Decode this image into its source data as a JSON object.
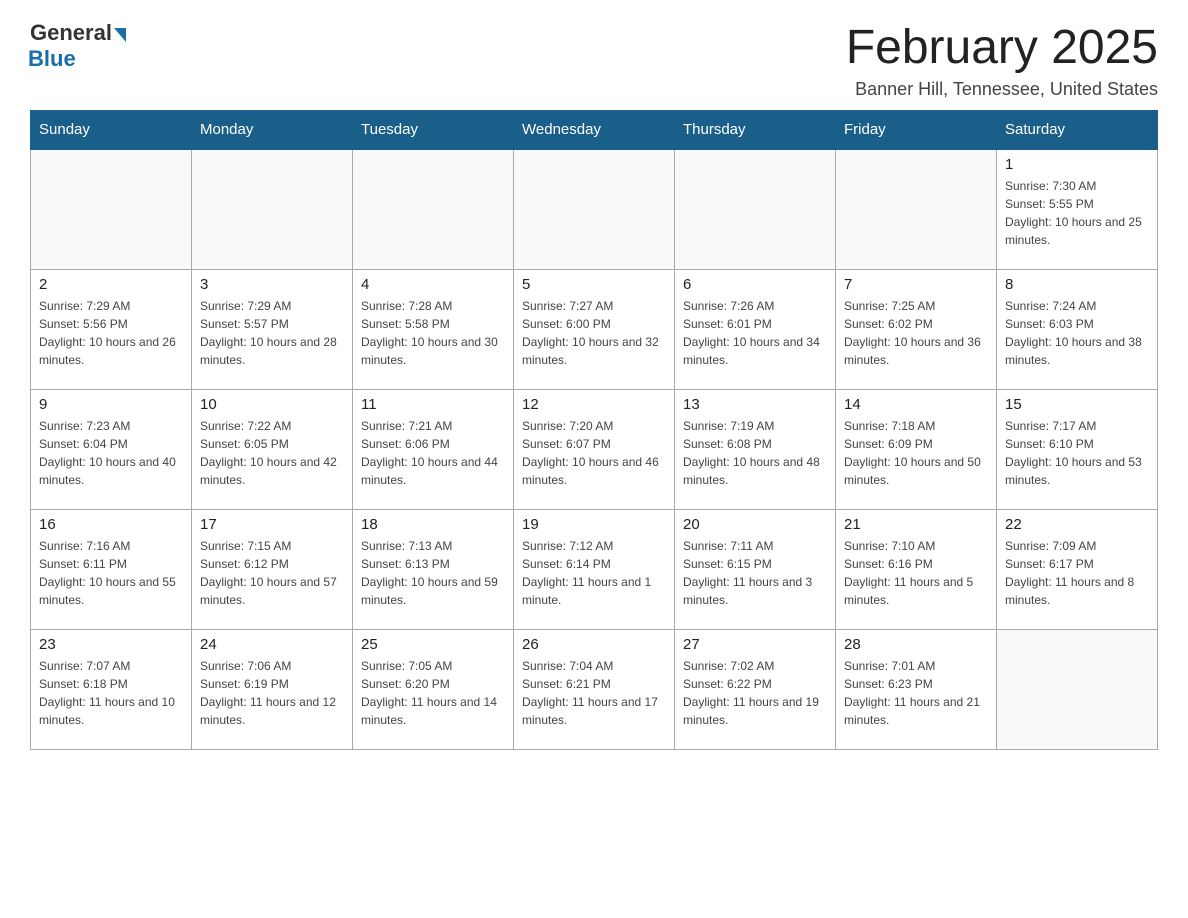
{
  "logo": {
    "general": "General",
    "blue": "Blue"
  },
  "title": {
    "month_year": "February 2025",
    "location": "Banner Hill, Tennessee, United States"
  },
  "weekdays": [
    "Sunday",
    "Monday",
    "Tuesday",
    "Wednesday",
    "Thursday",
    "Friday",
    "Saturday"
  ],
  "weeks": [
    [
      {
        "day": "",
        "info": ""
      },
      {
        "day": "",
        "info": ""
      },
      {
        "day": "",
        "info": ""
      },
      {
        "day": "",
        "info": ""
      },
      {
        "day": "",
        "info": ""
      },
      {
        "day": "",
        "info": ""
      },
      {
        "day": "1",
        "info": "Sunrise: 7:30 AM\nSunset: 5:55 PM\nDaylight: 10 hours and 25 minutes."
      }
    ],
    [
      {
        "day": "2",
        "info": "Sunrise: 7:29 AM\nSunset: 5:56 PM\nDaylight: 10 hours and 26 minutes."
      },
      {
        "day": "3",
        "info": "Sunrise: 7:29 AM\nSunset: 5:57 PM\nDaylight: 10 hours and 28 minutes."
      },
      {
        "day": "4",
        "info": "Sunrise: 7:28 AM\nSunset: 5:58 PM\nDaylight: 10 hours and 30 minutes."
      },
      {
        "day": "5",
        "info": "Sunrise: 7:27 AM\nSunset: 6:00 PM\nDaylight: 10 hours and 32 minutes."
      },
      {
        "day": "6",
        "info": "Sunrise: 7:26 AM\nSunset: 6:01 PM\nDaylight: 10 hours and 34 minutes."
      },
      {
        "day": "7",
        "info": "Sunrise: 7:25 AM\nSunset: 6:02 PM\nDaylight: 10 hours and 36 minutes."
      },
      {
        "day": "8",
        "info": "Sunrise: 7:24 AM\nSunset: 6:03 PM\nDaylight: 10 hours and 38 minutes."
      }
    ],
    [
      {
        "day": "9",
        "info": "Sunrise: 7:23 AM\nSunset: 6:04 PM\nDaylight: 10 hours and 40 minutes."
      },
      {
        "day": "10",
        "info": "Sunrise: 7:22 AM\nSunset: 6:05 PM\nDaylight: 10 hours and 42 minutes."
      },
      {
        "day": "11",
        "info": "Sunrise: 7:21 AM\nSunset: 6:06 PM\nDaylight: 10 hours and 44 minutes."
      },
      {
        "day": "12",
        "info": "Sunrise: 7:20 AM\nSunset: 6:07 PM\nDaylight: 10 hours and 46 minutes."
      },
      {
        "day": "13",
        "info": "Sunrise: 7:19 AM\nSunset: 6:08 PM\nDaylight: 10 hours and 48 minutes."
      },
      {
        "day": "14",
        "info": "Sunrise: 7:18 AM\nSunset: 6:09 PM\nDaylight: 10 hours and 50 minutes."
      },
      {
        "day": "15",
        "info": "Sunrise: 7:17 AM\nSunset: 6:10 PM\nDaylight: 10 hours and 53 minutes."
      }
    ],
    [
      {
        "day": "16",
        "info": "Sunrise: 7:16 AM\nSunset: 6:11 PM\nDaylight: 10 hours and 55 minutes."
      },
      {
        "day": "17",
        "info": "Sunrise: 7:15 AM\nSunset: 6:12 PM\nDaylight: 10 hours and 57 minutes."
      },
      {
        "day": "18",
        "info": "Sunrise: 7:13 AM\nSunset: 6:13 PM\nDaylight: 10 hours and 59 minutes."
      },
      {
        "day": "19",
        "info": "Sunrise: 7:12 AM\nSunset: 6:14 PM\nDaylight: 11 hours and 1 minute."
      },
      {
        "day": "20",
        "info": "Sunrise: 7:11 AM\nSunset: 6:15 PM\nDaylight: 11 hours and 3 minutes."
      },
      {
        "day": "21",
        "info": "Sunrise: 7:10 AM\nSunset: 6:16 PM\nDaylight: 11 hours and 5 minutes."
      },
      {
        "day": "22",
        "info": "Sunrise: 7:09 AM\nSunset: 6:17 PM\nDaylight: 11 hours and 8 minutes."
      }
    ],
    [
      {
        "day": "23",
        "info": "Sunrise: 7:07 AM\nSunset: 6:18 PM\nDaylight: 11 hours and 10 minutes."
      },
      {
        "day": "24",
        "info": "Sunrise: 7:06 AM\nSunset: 6:19 PM\nDaylight: 11 hours and 12 minutes."
      },
      {
        "day": "25",
        "info": "Sunrise: 7:05 AM\nSunset: 6:20 PM\nDaylight: 11 hours and 14 minutes."
      },
      {
        "day": "26",
        "info": "Sunrise: 7:04 AM\nSunset: 6:21 PM\nDaylight: 11 hours and 17 minutes."
      },
      {
        "day": "27",
        "info": "Sunrise: 7:02 AM\nSunset: 6:22 PM\nDaylight: 11 hours and 19 minutes."
      },
      {
        "day": "28",
        "info": "Sunrise: 7:01 AM\nSunset: 6:23 PM\nDaylight: 11 hours and 21 minutes."
      },
      {
        "day": "",
        "info": ""
      }
    ]
  ]
}
